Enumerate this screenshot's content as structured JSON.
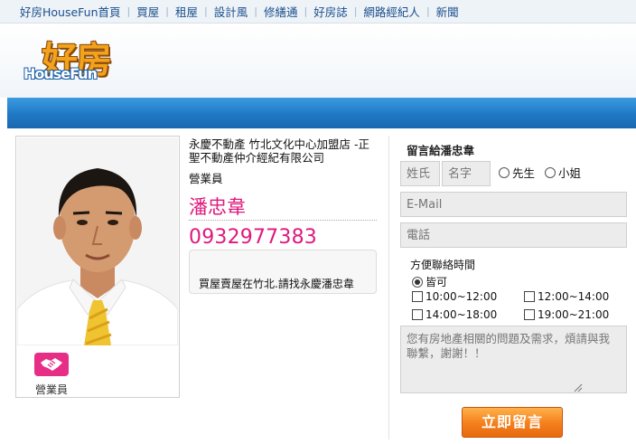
{
  "nav": {
    "items": [
      "好房HouseFun首頁",
      "買屋",
      "租屋",
      "設計風",
      "修繕通",
      "好房誌",
      "網路經紀人",
      "新聞"
    ]
  },
  "logo": {
    "main": "好房",
    "sub": "HouseFun"
  },
  "agent": {
    "company": "永慶不動產 竹北文化中心加盟店 -正聖不動產仲介經紀有限公司",
    "position": "營業員",
    "name": "潘忠韋",
    "phone": "0932977383",
    "slogan": "買屋賣屋在竹北.請找永慶潘忠韋",
    "role_label": "營業員"
  },
  "form": {
    "title": "留言給潘忠韋",
    "surname_placeholder": "姓氏",
    "givenname_placeholder": "名字",
    "mr_label": "先生",
    "ms_label": "小姐",
    "email_placeholder": "E-Mail",
    "phone_placeholder": "電話",
    "contact_time_label": "方便聯絡時間",
    "any_time_label": "皆可",
    "time_slots": [
      "10:00~12:00",
      "12:00~14:00",
      "14:00~18:00",
      "19:00~21:00"
    ],
    "message_placeholder": "您有房地產相關的問題及需求，煩請與我聯繫，謝謝！！",
    "submit_label": "立即留言"
  },
  "colors": {
    "accent_pink": "#e0197d",
    "nav_link": "#1b4f8c",
    "band_blue": "#1f78c5",
    "submit_orange": "#f47f1c"
  }
}
